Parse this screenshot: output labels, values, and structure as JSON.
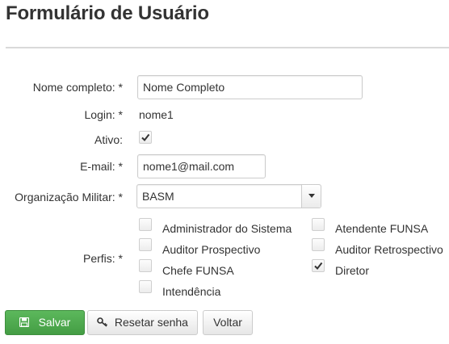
{
  "page": {
    "title": "Formulário de Usuário"
  },
  "form": {
    "nome": {
      "label": "Nome completo: *",
      "value": "Nome Completo"
    },
    "login": {
      "label": "Login: *",
      "value": "nome1"
    },
    "ativo": {
      "label": "Ativo:",
      "checked": true
    },
    "email": {
      "label": "E-mail: *",
      "value": "nome1@mail.com"
    },
    "organizacao": {
      "label": "Organização Militar: *",
      "value": "BASM"
    },
    "perfis": {
      "label": "Perfis: *",
      "options": [
        {
          "label": "Administrador do Sistema",
          "checked": false
        },
        {
          "label": "Atendente FUNSA",
          "checked": false
        },
        {
          "label": "Auditor Prospectivo",
          "checked": false
        },
        {
          "label": "Auditor Retrospectivo",
          "checked": false
        },
        {
          "label": "Chefe FUNSA",
          "checked": false
        },
        {
          "label": "Diretor",
          "checked": true
        },
        {
          "label": "Intendência",
          "checked": false
        }
      ]
    }
  },
  "actions": {
    "save": {
      "label": "Salvar",
      "icon": "floppy-disk-icon"
    },
    "reset": {
      "label": "Resetar senha",
      "icon": "key-icon"
    },
    "back": {
      "label": "Voltar"
    }
  },
  "colors": {
    "success": "#5cb85c",
    "border": "#cccccc",
    "text": "#333333"
  }
}
